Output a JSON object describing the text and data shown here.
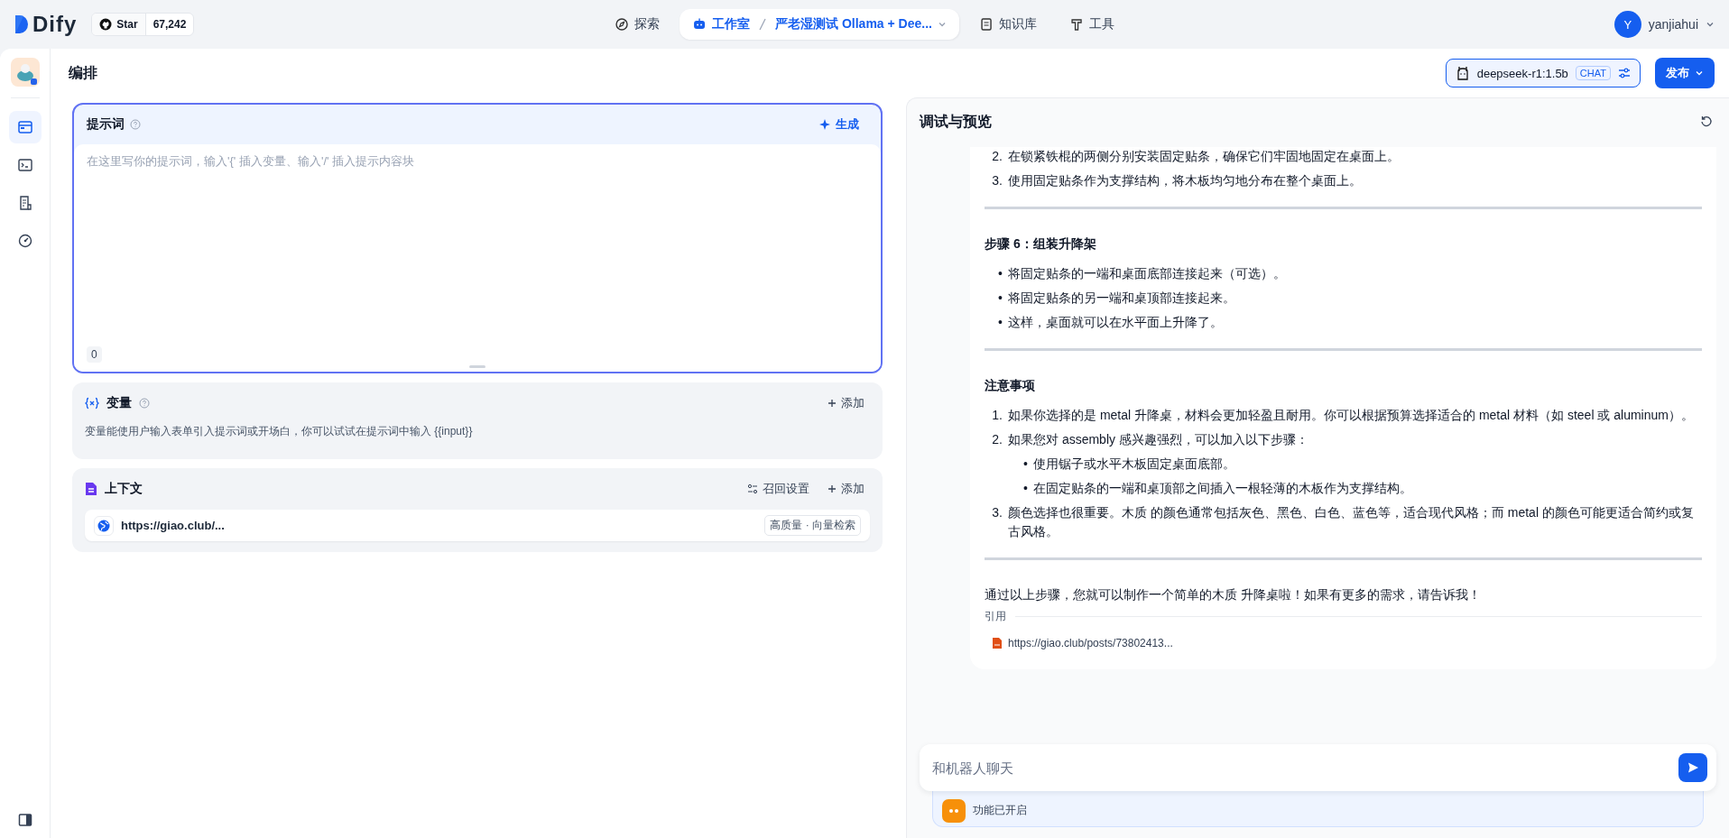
{
  "top_bar": {
    "logo": "Dify",
    "github": {
      "label": "Star",
      "count": "67,242"
    },
    "nav": [
      {
        "kind": "explore",
        "label": "探索",
        "selected": false
      },
      {
        "kind": "studio",
        "label": "工作室",
        "app": "严老湿测试 Ollama + Dee...",
        "selected": true
      },
      {
        "kind": "knowledge",
        "label": "知识库",
        "selected": false
      },
      {
        "kind": "tools",
        "label": "工具",
        "selected": false
      }
    ],
    "user": {
      "initial": "Y",
      "name": "yanjiahui"
    }
  },
  "sidebar": {
    "items": [
      {
        "kind": "orchestrate",
        "selected": true
      },
      {
        "kind": "api",
        "selected": false
      },
      {
        "kind": "logs",
        "selected": false
      },
      {
        "kind": "monitor",
        "selected": false
      }
    ]
  },
  "header": {
    "title": "编排",
    "model": {
      "name": "deepseek-r1:1.5b",
      "mode": "CHAT"
    },
    "publish": "发布"
  },
  "prompt": {
    "title": "提示词",
    "generate": "生成",
    "placeholder": "在这里写你的提示词，输入'{' 插入变量、输入'/' 插入提示内容块",
    "count": "0"
  },
  "variables": {
    "title": "变量",
    "add": "添加",
    "description": "变量能使用户输入表单引入提示词或开场白，你可以试试在提示词中输入 {{input}}"
  },
  "context": {
    "title": "上下文",
    "settings": "召回设置",
    "add": "添加",
    "items": [
      {
        "name": "https://giao.club/...",
        "tag": "高质量 · 向量检索"
      }
    ]
  },
  "debug": {
    "title": "调试与预览",
    "blocks": [
      {
        "kind": "list",
        "items": [
          {
            "marker": "2.",
            "text": "在锁紧铁棍的两侧分别安装固定贴条，确保它们牢固地固定在桌面上。"
          },
          {
            "marker": "3.",
            "text": "使用固定贴条作为支撑结构，将木板均匀地分布在整个桌面上。"
          }
        ]
      },
      {
        "kind": "rule"
      },
      {
        "kind": "heading",
        "text": "步骤 6：组装升降架"
      },
      {
        "kind": "list",
        "items": [
          {
            "marker": "•",
            "text": "将固定贴条的一端和桌面底部连接起来（可选）。"
          },
          {
            "marker": "•",
            "text": "将固定贴条的另一端和桌顶部连接起来。"
          },
          {
            "marker": "•",
            "text": "这样，桌面就可以在水平面上升降了。"
          }
        ]
      },
      {
        "kind": "rule"
      },
      {
        "kind": "heading",
        "text": "注意事项"
      },
      {
        "kind": "list",
        "items": [
          {
            "marker": "1.",
            "text": "如果你选择的是 metal 升降桌，材料会更加轻盈且耐用。你可以根据预算选择适合的 metal 材料（如 steel 或 aluminum）。"
          },
          {
            "marker": "2.",
            "text": "如果您对 assembly 感兴趣强烈，可以加入以下步骤：",
            "children": [
              {
                "marker": "•",
                "text": "使用锯子或水平木板固定桌面底部。"
              },
              {
                "marker": "•",
                "text": "在固定贴条的一端和桌顶部之间插入一根轻薄的木板作为支撑结构。"
              }
            ]
          },
          {
            "marker": "3.",
            "text": "颜色选择也很重要。木质 的颜色通常包括灰色、黑色、白色、蓝色等，适合现代风格；而 metal 的颜色可能更适合简约或复古风格。"
          }
        ]
      },
      {
        "kind": "rule"
      },
      {
        "kind": "paragraph",
        "text": "通过以上步骤，您就可以制作一个简单的木质 升降桌啦！如果有更多的需求，请告诉我！"
      }
    ],
    "citation": {
      "label": "引用",
      "items": [
        {
          "name": "https://giao.club/posts/73802413..."
        }
      ]
    },
    "input": {
      "placeholder": "和机器人聊天"
    },
    "features": "功能已开启"
  }
}
